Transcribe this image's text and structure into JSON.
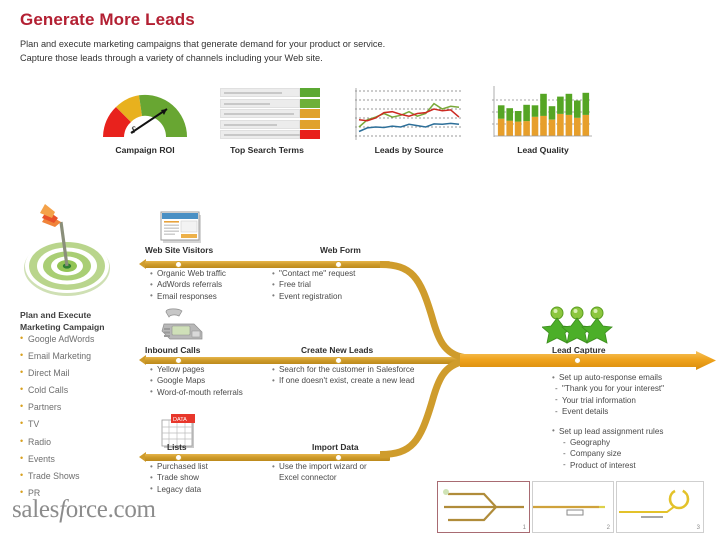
{
  "header": {
    "title": "Generate More Leads",
    "subtitle": "Plan and execute marketing campaigns that generate demand for your product or service.\nCapture those leads through a variety of channels including your Web site.",
    "title_color": "#b32033"
  },
  "dashboard": {
    "items": [
      {
        "label": "Campaign ROI",
        "type": "gauge",
        "value_marker": "$"
      },
      {
        "label": "Top Search Terms",
        "type": "table"
      },
      {
        "label": "Leads by Source",
        "type": "line"
      },
      {
        "label": "Lead Quality",
        "type": "bar"
      }
    ]
  },
  "chart_data": [
    {
      "type": "gauge",
      "title": "Campaign ROI",
      "needle_label": "$",
      "bands": [
        {
          "name": "low",
          "color": "#e8221d",
          "from": 0,
          "to": 33
        },
        {
          "name": "medium",
          "color": "#e8b11e",
          "from": 33,
          "to": 58
        },
        {
          "name": "high",
          "color": "#68a632",
          "from": 58,
          "to": 100
        }
      ],
      "needle_value": 72
    },
    {
      "type": "table",
      "title": "Top Search Terms",
      "rows": [
        {
          "fill": 60,
          "status_color": "#5ba832"
        },
        {
          "fill": 48,
          "status_color": "#6db038"
        },
        {
          "fill": 72,
          "status_color": "#e0a22c"
        },
        {
          "fill": 55,
          "status_color": "#e0a22c"
        },
        {
          "fill": 84,
          "status_color": "#e81f1b"
        }
      ]
    },
    {
      "type": "line",
      "title": "Leads by Source",
      "grid": true,
      "ylim": [
        0,
        10
      ],
      "series": [
        {
          "name": "green",
          "color": "#7aa83a",
          "values": [
            2.0,
            3.6,
            4.2,
            5.0,
            4.2,
            4.6,
            5.4,
            4.4,
            5.0,
            7.2,
            6.0,
            6.6,
            6.4
          ]
        },
        {
          "name": "red",
          "color": "#cc2a22",
          "values": [
            3.6,
            3.4,
            4.0,
            5.2,
            5.4,
            4.8,
            4.4,
            5.0,
            5.2,
            6.0,
            5.6,
            5.8,
            4.2
          ]
        },
        {
          "name": "blue",
          "color": "#2d6f99",
          "values": [
            1.0,
            1.8,
            2.0,
            1.9,
            2.2,
            2.0,
            2.6,
            2.3,
            2.0,
            2.7,
            2.6,
            2.8,
            2.6
          ]
        }
      ]
    },
    {
      "type": "bar",
      "title": "Lead Quality",
      "grid": true,
      "ylim": [
        0,
        10
      ],
      "stacked": true,
      "series": [
        {
          "name": "orange",
          "color": "#e79f2b",
          "values": [
            3.6,
            3.2,
            3.0,
            3.1,
            4.0,
            4.2,
            3.4,
            4.6,
            4.4,
            3.8,
            4.4
          ]
        },
        {
          "name": "green",
          "color": "#55a524",
          "values": [
            2.8,
            2.6,
            2.2,
            3.4,
            2.4,
            4.6,
            2.8,
            3.6,
            4.4,
            3.6,
            4.6
          ]
        }
      ]
    }
  ],
  "campaign": {
    "icon": "dartboard-icon",
    "title": "Plan and Execute\nMarketing Campaign",
    "items": [
      "Google AdWords",
      "Email Marketing",
      "Direct Mail",
      "Cold Calls",
      "Partners",
      "TV",
      "Radio",
      "Events",
      "Trade Shows",
      "PR"
    ]
  },
  "flow": {
    "rows": [
      {
        "icon": "web-page-icon",
        "left_stage": {
          "name": "Web Site Visitors",
          "items": [
            "Organic Web traffic",
            "AdWords referrals",
            "Email responses"
          ]
        },
        "right_stage": {
          "name": "Web Form",
          "items": [
            "\"Contact me\" request",
            "Free trial",
            "Event registration"
          ]
        }
      },
      {
        "icon": "desk-phone-icon",
        "left_stage": {
          "name": "Inbound Calls",
          "items": [
            "Yellow pages",
            "Google Maps",
            "Word-of-mouth referrals"
          ]
        },
        "right_stage": {
          "name": "Create New Leads",
          "items": [
            "Search for the customer in Salesforce",
            "If one doesn't exist, create a new lead"
          ]
        }
      },
      {
        "icon": "data-spreadsheet-icon",
        "left_stage": {
          "name": "Lists",
          "items": [
            "Purchased list",
            "Trade show",
            "Legacy data"
          ]
        },
        "right_stage": {
          "name": "Import Data",
          "items": [
            "Use the import wizard or",
            "Excel connector"
          ]
        }
      }
    ],
    "capture": {
      "icon": "three-people-icon",
      "name": "Lead Capture",
      "items": [
        {
          "text": "Set up auto-response emails",
          "level": 0
        },
        {
          "text": "\"Thank you for your interest\"",
          "level": 1
        },
        {
          "text": "Your trial information",
          "level": 1
        },
        {
          "text": "Event details",
          "level": 1
        },
        {
          "text": "",
          "level": 9
        },
        {
          "text": "Set up lead assignment rules",
          "level": 0
        },
        {
          "text": "Geography",
          "level": 2
        },
        {
          "text": "Company size",
          "level": 2
        },
        {
          "text": "Product of interest",
          "level": 2
        }
      ]
    },
    "bar_color": "#cf9c2c",
    "arrow_color": "#efa31d"
  },
  "logo": {
    "part1": "sal",
    "part2": "es",
    "part3": "f",
    "part4": "orce.com"
  },
  "thumbnails": [
    {
      "number": "1",
      "selected": true
    },
    {
      "number": "2",
      "selected": false
    },
    {
      "number": "3",
      "selected": false
    }
  ]
}
